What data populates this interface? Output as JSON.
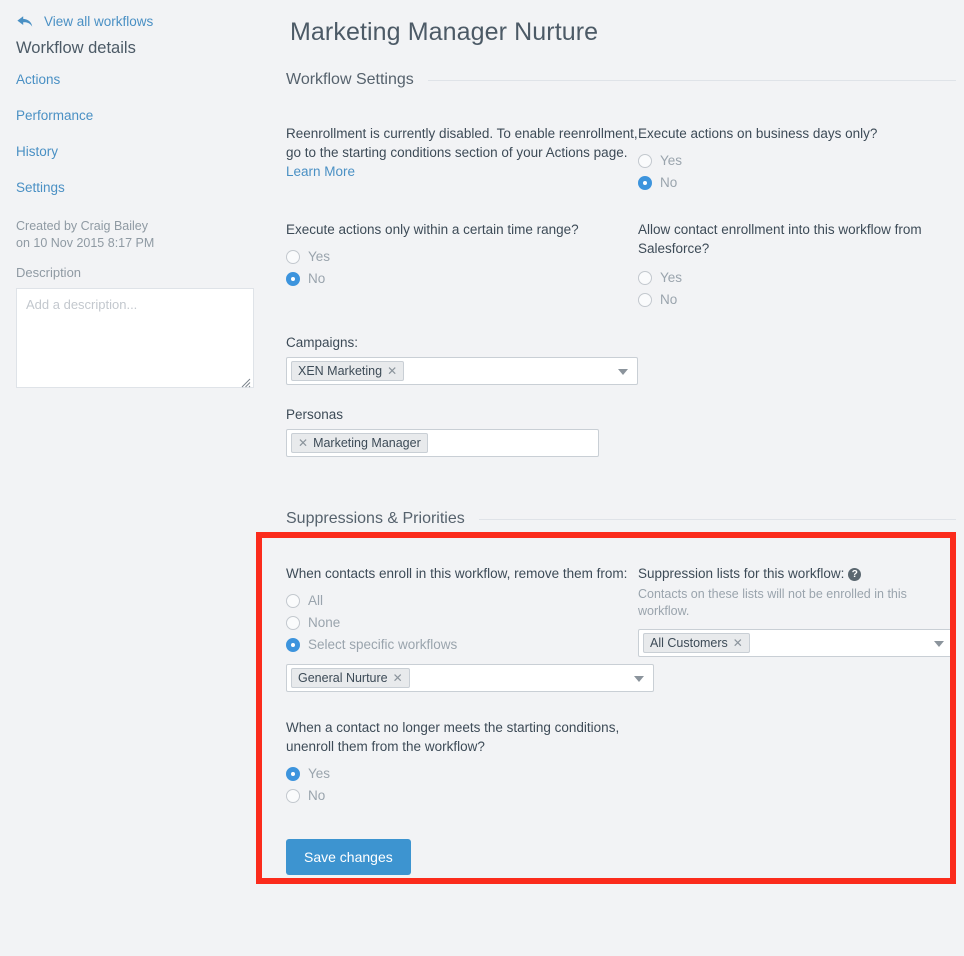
{
  "sidebar": {
    "back_link": "View all workflows",
    "details_title": "Workflow details",
    "nav": [
      {
        "label": "Actions"
      },
      {
        "label": "Performance"
      },
      {
        "label": "History"
      },
      {
        "label": "Settings"
      }
    ],
    "created_by_line1": "Created by Craig Bailey",
    "created_by_line2": "on 10 Nov 2015 8:17 PM",
    "description_label": "Description",
    "description_value": "",
    "description_placeholder": "Add a description..."
  },
  "header": {
    "title": "Marketing Manager Nurture"
  },
  "workflow_settings": {
    "section_title": "Workflow Settings",
    "reenrollment_text": "Reenrollment is currently disabled. To enable reenrollment, go to the starting conditions section of your Actions page. ",
    "learn_more": "Learn More",
    "business_days": {
      "question": "Execute actions on business days only?",
      "options": [
        {
          "label": "Yes",
          "selected": false
        },
        {
          "label": "No",
          "selected": true
        }
      ]
    },
    "time_range": {
      "question": "Execute actions only within a certain time range?",
      "options": [
        {
          "label": "Yes",
          "selected": false
        },
        {
          "label": "No",
          "selected": true
        }
      ]
    },
    "salesforce": {
      "question": "Allow contact enrollment into this workflow from Salesforce?",
      "options": [
        {
          "label": "Yes",
          "selected": false
        },
        {
          "label": "No",
          "selected": false
        }
      ]
    },
    "campaigns": {
      "label": "Campaigns:",
      "tokens": [
        "XEN Marketing"
      ]
    },
    "personas": {
      "label": "Personas",
      "tokens": [
        "Marketing Manager"
      ]
    }
  },
  "suppressions": {
    "section_title": "Suppressions & Priorities",
    "remove_from": {
      "question": "When contacts enroll in this workflow, remove them from:",
      "options": [
        {
          "label": "All",
          "selected": false
        },
        {
          "label": "None",
          "selected": false
        },
        {
          "label": "Select specific workflows",
          "selected": true
        }
      ],
      "tokens": [
        "General Nurture"
      ]
    },
    "suppression_lists": {
      "label": "Suppression lists for this workflow:",
      "help_glyph": "?",
      "note": "Contacts on these lists will not be enrolled in this workflow.",
      "tokens": [
        "All Customers"
      ]
    },
    "unenroll": {
      "question": "When a contact no longer meets the starting conditions, unenroll them from the workflow?",
      "options": [
        {
          "label": "Yes",
          "selected": true
        },
        {
          "label": "No",
          "selected": false
        }
      ]
    }
  },
  "footer": {
    "save_label": "Save changes"
  },
  "colors": {
    "accent_blue": "#3d94d0",
    "link_blue": "#4a90c4",
    "highlight_red": "#fb2b1c",
    "page_bg": "#f2f3f5"
  }
}
